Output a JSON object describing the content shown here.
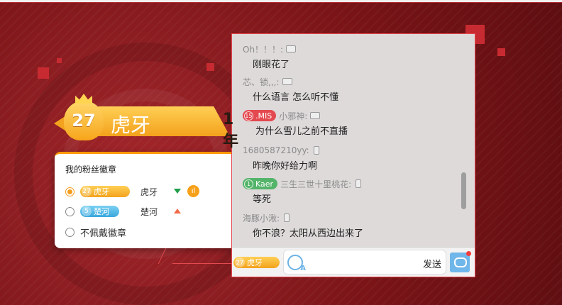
{
  "fan_badge": {
    "level": "27",
    "name": "虎牙",
    "year_badge": "1年"
  },
  "popup": {
    "title": "我的粉丝徽章",
    "options": [
      {
        "level": "27",
        "badge_name": "虎牙",
        "owner": "虎牙",
        "trend": "down",
        "selected": true
      },
      {
        "level": "5",
        "badge_name": "楚河",
        "owner": "楚河",
        "trend": "up",
        "selected": false
      },
      {
        "label": "不佩戴徽章",
        "selected": false
      }
    ]
  },
  "chat": {
    "messages": [
      {
        "user": "Oh！！！:",
        "device": "pc",
        "text": "刚眼花了"
      },
      {
        "user": "芯、锁,,,:",
        "device": "pc",
        "text": "什么语言 怎么听不懂"
      },
      {
        "badge_level": "15",
        "badge_name": ".MIS",
        "user": "小邪神:",
        "device": "pc",
        "text": "为什么雪儿之前不直播"
      },
      {
        "user": "1680587210yy:",
        "device": "phone",
        "text": "昨晚你好给力啊"
      },
      {
        "badge_level": "1",
        "badge_name": "Kaer",
        "user": "三生三世十里桃花:",
        "device": "phone",
        "text": "等死"
      },
      {
        "user": "海豚小湫:",
        "device": "phone",
        "text": "你不浪？太阳从西边出来了"
      }
    ],
    "input": {
      "badge_level": "27",
      "badge_name": "虎牙",
      "send_label": "发送",
      "value": ""
    }
  },
  "colors": {
    "background": "#7e1518",
    "badge_gold": "#f3a21c",
    "badge_blue": "#39a7dc",
    "accent_orange": "#ff9900",
    "panel_border": "#e8474d"
  }
}
